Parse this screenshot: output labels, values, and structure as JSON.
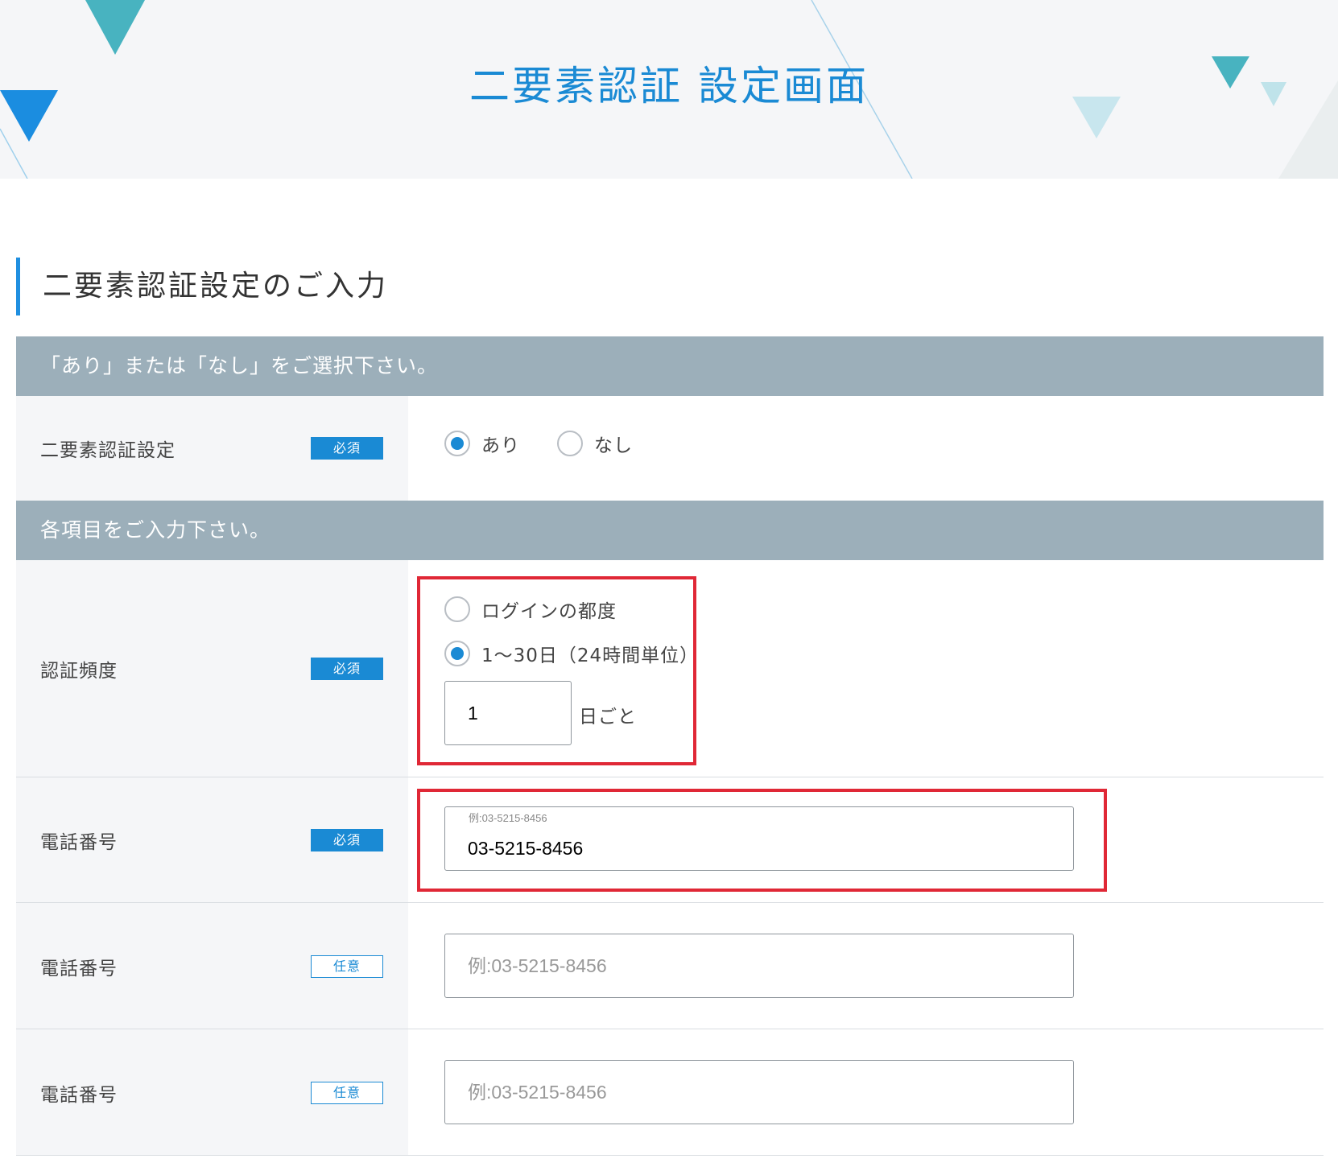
{
  "header": {
    "title": "二要素認証 設定画面"
  },
  "section": {
    "heading": "二要素認証設定のご入力"
  },
  "band_select": {
    "text": "「あり」または「なし」をご選択下さい。"
  },
  "band_input": {
    "text": "各項目をご入力下さい。"
  },
  "two_factor": {
    "label": "二要素認証設定",
    "badge": "必須",
    "options": [
      "あり",
      "なし"
    ],
    "selected": "あり"
  },
  "auth_frequency": {
    "label": "認証頻度",
    "badge": "必須",
    "options": [
      "ログインの都度",
      "1〜30日（24時間単位）"
    ],
    "selected": "1〜30日（24時間単位）",
    "days_value": "1",
    "days_suffix": "日ごと"
  },
  "phone_primary": {
    "label": "電話番号",
    "badge": "必須",
    "hint": "例:03-5215-8456",
    "value": "03-5215-8456"
  },
  "phone_secondary": {
    "label": "電話番号",
    "badge": "任意",
    "placeholder": "例:03-5215-8456"
  },
  "phone_tertiary": {
    "label": "電話番号",
    "badge": "任意",
    "placeholder": "例:03-5215-8456"
  },
  "colors": {
    "accent": "#1a8ad4",
    "band": "#9cafba",
    "highlight": "#e02836",
    "label_bg": "#f5f6f8"
  }
}
